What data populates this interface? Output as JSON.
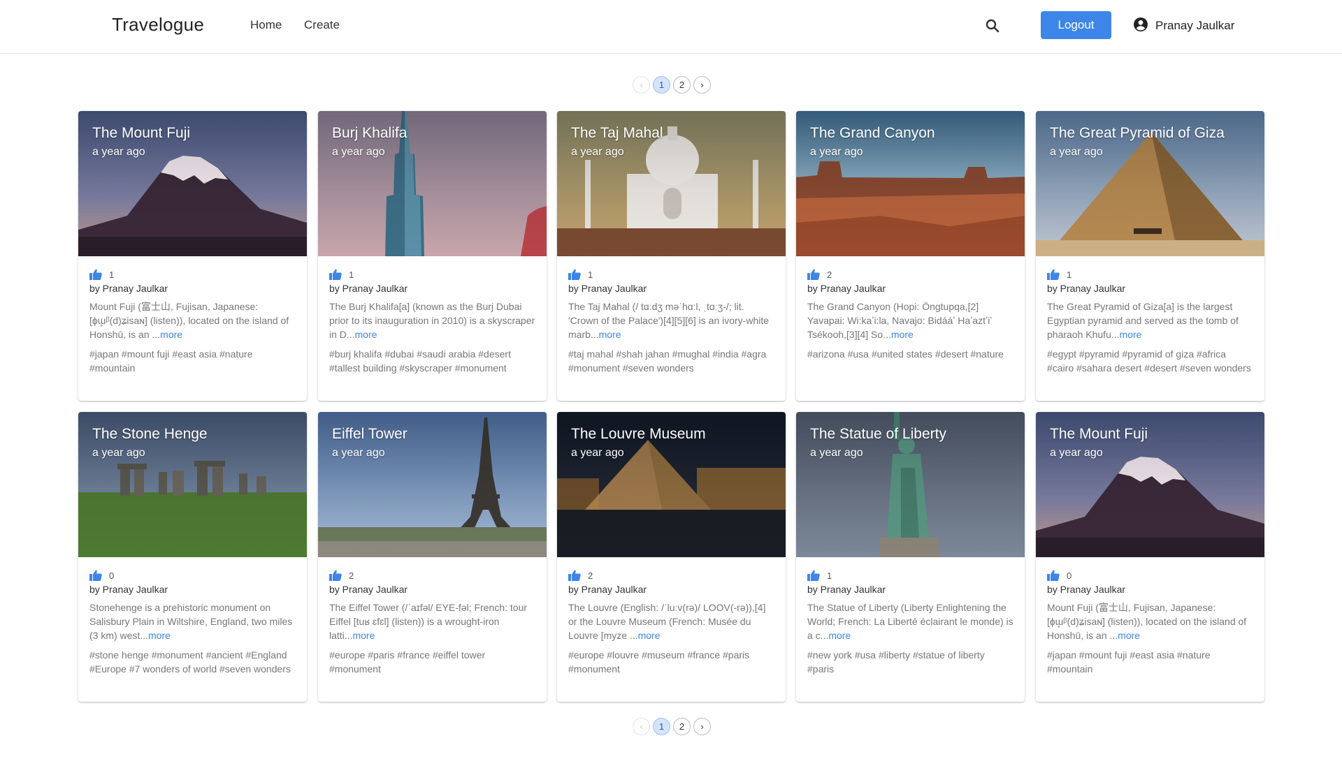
{
  "nav": {
    "brand": "Travelogue",
    "home": "Home",
    "create": "Create",
    "logout": "Logout",
    "user_name": "Pranay Jaulkar",
    "accent": "#3d86e8"
  },
  "pagination": {
    "prev": "‹",
    "pages": [
      "1",
      "2"
    ],
    "active": "1",
    "next": "›"
  },
  "cards": [
    {
      "title": "The Mount Fuji",
      "time": "a year ago",
      "likes": "1",
      "author": "by Pranay Jaulkar",
      "desc": "Mount Fuji (富士山, Fujisan, Japanese: [ɸɯ̥ᵝ(d)ʑisaɴ] (listen)), located on the island of Honshū, is an ...",
      "more": "more",
      "tags": "#japan #mount fuji #east asia #nature #mountain"
    },
    {
      "title": "Burj Khalifa",
      "time": "a year ago",
      "likes": "1",
      "author": "by Pranay Jaulkar",
      "desc": "The Burj Khalifa[a] (known as the Burj Dubai prior to its inauguration in 2010) is a skyscraper in D...",
      "more": "more",
      "tags": "#burj khalifa #dubai #saudi arabia #desert #tallest building #skyscraper #monument"
    },
    {
      "title": "The Taj Mahal",
      "time": "a year ago",
      "likes": "1",
      "author": "by Pranay Jaulkar",
      "desc": "The Taj Mahal (/ tɑːdʒ məˈhɑːl, ˌtɑːʒ-/; lit. 'Crown of the Palace')[4][5][6] is an ivory-white marb...",
      "more": "more",
      "tags": "#taj mahal #shah jahan #mughal #india #agra #monument #seven wonders"
    },
    {
      "title": "The Grand Canyon",
      "time": "a year ago",
      "likes": "2",
      "author": "by Pranay Jaulkar",
      "desc": "The Grand Canyon (Hopi: Öngtupqa,[2] Yavapai: Wi:kaʼi:la, Navajo: Bidááʼ Haʼaztʼiʼ Tsékooh,[3][4] So...",
      "more": "more",
      "tags": "#arizona #usa #united states #desert #nature"
    },
    {
      "title": "The Great Pyramid of Giza",
      "time": "a year ago",
      "likes": "1",
      "author": "by Pranay Jaulkar",
      "desc": "The Great Pyramid of Giza[a] is the largest Egyptian pyramid and served as the tomb of pharaoh Khufu...",
      "more": "more",
      "tags": "#egypt #pyramid #pyramid of giza #africa #cairo #sahara desert #desert #seven wonders"
    },
    {
      "title": "The Stone Henge",
      "time": "a year ago",
      "likes": "0",
      "author": "by Pranay Jaulkar",
      "desc": "Stonehenge is a prehistoric monument on Salisbury Plain in Wiltshire, England, two miles (3 km) west...",
      "more": "more",
      "tags": "#stone henge #monument #ancient #England #Europe #7 wonders of world #seven wonders"
    },
    {
      "title": "Eiffel Tower",
      "time": "a year ago",
      "likes": "2",
      "author": "by Pranay Jaulkar",
      "desc": "The Eiffel Tower (/ˈaɪfəl/ EYE-fəl; French: tour Eiffel [tuʁ ɛfɛl] (listen)) is a wrought-iron latti...",
      "more": "more",
      "tags": "#europe #paris #france #eiffel tower #monument"
    },
    {
      "title": "The Louvre Museum",
      "time": "a year ago",
      "likes": "2",
      "author": "by Pranay Jaulkar",
      "desc": "The Louvre (English: /ˈluːv(rə)/ LOOV(-rə)),[4] or the Louvre Museum (French: Musée du Louvre [myze ...",
      "more": "more",
      "tags": "#europe #louvre #museum #france #paris #monument"
    },
    {
      "title": "The Statue of Liberty",
      "time": "a year ago",
      "likes": "1",
      "author": "by Pranay Jaulkar",
      "desc": "The Statue of Liberty (Liberty Enlightening the World; French: La Liberté éclairant le monde) is a c...",
      "more": "more",
      "tags": "#new york #usa #liberty #statue of liberty #paris"
    },
    {
      "title": "The Mount Fuji",
      "time": "a year ago",
      "likes": "0",
      "author": "by Pranay Jaulkar",
      "desc": "Mount Fuji (富士山, Fujisan, Japanese: [ɸɯ̥ᵝ(d)ʑisaɴ] (listen)), located on the island of Honshū, is an ...",
      "more": "more",
      "tags": "#japan #mount fuji #east asia #nature #mountain"
    }
  ]
}
